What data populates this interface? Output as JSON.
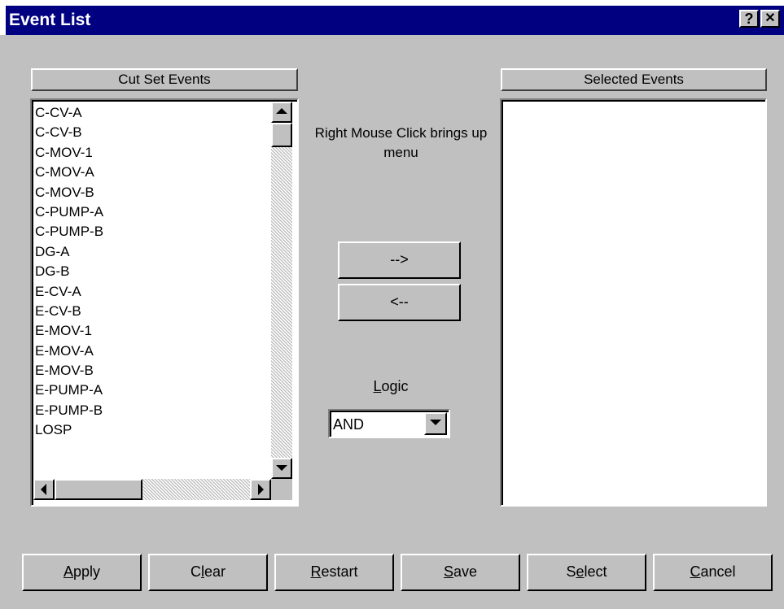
{
  "window": {
    "title": "Event List",
    "help_glyph": "?",
    "close_glyph": "✕"
  },
  "left_panel": {
    "header": "Cut Set Events",
    "items": [
      "C-CV-A",
      "C-CV-B",
      "C-MOV-1",
      "C-MOV-A",
      "C-MOV-B",
      "C-PUMP-A",
      "C-PUMP-B",
      "DG-A",
      "DG-B",
      "E-CV-A",
      "E-CV-B",
      "E-MOV-1",
      "E-MOV-A",
      "E-MOV-B",
      "E-PUMP-A",
      "E-PUMP-B",
      "LOSP"
    ]
  },
  "right_panel": {
    "header": "Selected Events",
    "items": []
  },
  "middle": {
    "hint": "Right Mouse Click brings up menu",
    "add_label": "-->",
    "remove_label": "<--",
    "logic_label_prefix": "",
    "logic_label_underlined": "L",
    "logic_label_rest": "ogic",
    "logic_value": "AND"
  },
  "footer": {
    "buttons": [
      {
        "pre": "",
        "ul": "A",
        "post": "pply"
      },
      {
        "pre": "C",
        "ul": "l",
        "post": "ear"
      },
      {
        "pre": "",
        "ul": "R",
        "post": "estart"
      },
      {
        "pre": "",
        "ul": "S",
        "post": "ave"
      },
      {
        "pre": "S",
        "ul": "e",
        "post": "lect"
      },
      {
        "pre": "",
        "ul": "C",
        "post": "ancel"
      }
    ]
  }
}
